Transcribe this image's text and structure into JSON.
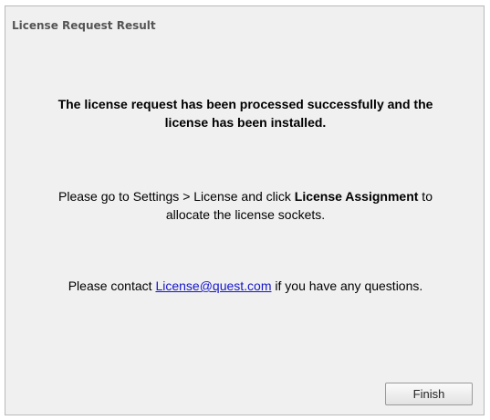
{
  "dialog": {
    "title": "License Request Result",
    "success_line_1": "The license request has been processed successfully and the",
    "success_line_2": "license has been installed.",
    "instruction_line_1_pre": "Please go to Settings > License and click ",
    "instruction_line_1_bold": "License Assignment",
    "instruction_line_1_post": " to",
    "instruction_line_2": "allocate the license sockets.",
    "contact_pre": "Please contact ",
    "contact_email": "License@quest.com",
    "contact_post": " if you have any questions.",
    "finish_label": "Finish"
  }
}
